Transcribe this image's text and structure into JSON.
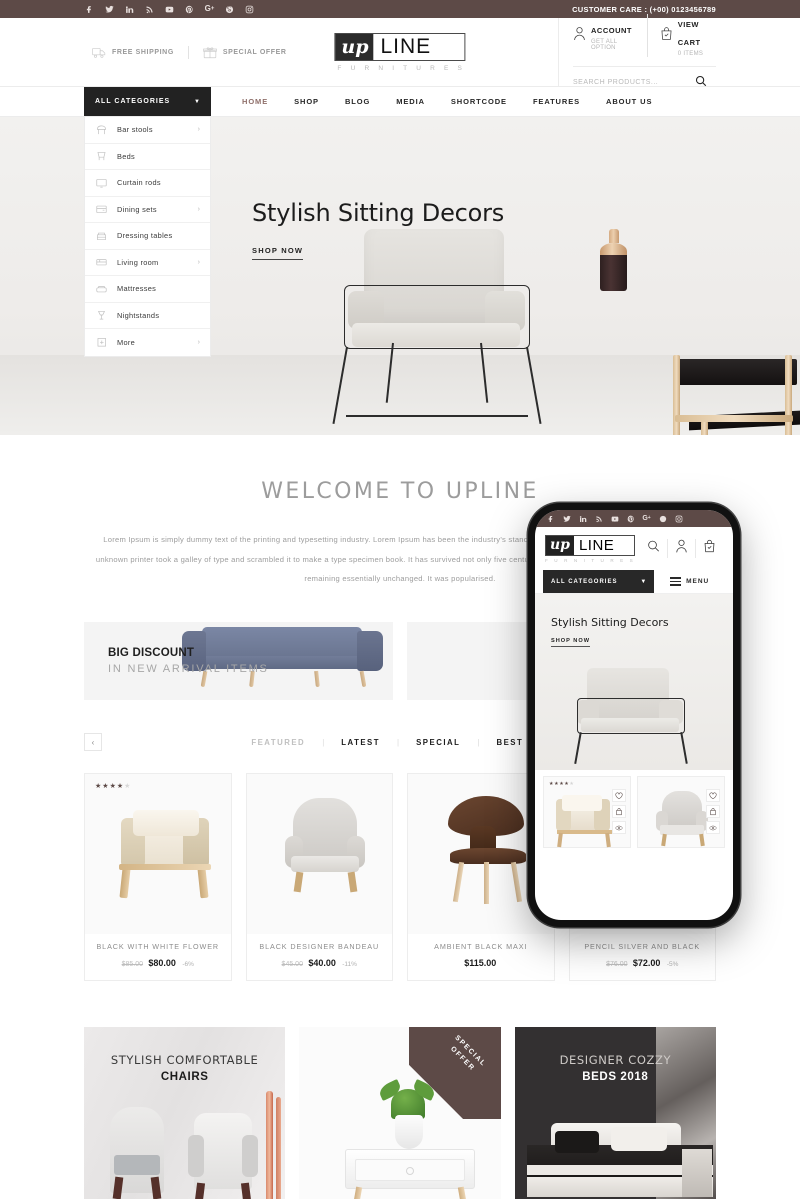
{
  "topbar": {
    "social": [
      {
        "name": "facebook-icon",
        "glyph": "f"
      },
      {
        "name": "twitter-icon",
        "glyph": "t"
      },
      {
        "name": "linkedin-icon",
        "glyph": "in"
      },
      {
        "name": "rss-icon",
        "glyph": "r"
      },
      {
        "name": "youtube-icon",
        "glyph": "y"
      },
      {
        "name": "pinterest-icon",
        "glyph": "p"
      },
      {
        "name": "google-plus-icon",
        "glyph": "G+"
      },
      {
        "name": "skype-icon",
        "glyph": "s"
      },
      {
        "name": "instagram-icon",
        "glyph": "i"
      }
    ],
    "customer_care": "CUSTOMER CARE : (+00) 0123456789",
    "bg_color": "#5d4a47"
  },
  "header": {
    "features": [
      {
        "icon": "truck-icon",
        "label": "FREE SHIPPING"
      },
      {
        "icon": "gift-icon",
        "label": "SPECIAL OFFER"
      }
    ],
    "logo": {
      "up": "up",
      "line": "LINE",
      "sub": "F U R N I T U R E S"
    },
    "account": {
      "title": "ACCOUNT",
      "sub": "GET ALL OPTION",
      "icon": "user-icon"
    },
    "cart": {
      "title": "VIEW CART",
      "sub": "0 ITEMS",
      "icon": "bag-icon"
    },
    "search": {
      "placeholder": "SEARCH PRODUCTS...",
      "value": "",
      "icon": "search-icon"
    }
  },
  "nav": {
    "categories_label": "ALL CATEGORIES",
    "items": [
      {
        "label": "HOME",
        "active": true
      },
      {
        "label": "SHOP",
        "active": false
      },
      {
        "label": "BLOG",
        "active": false
      },
      {
        "label": "MEDIA",
        "active": false
      },
      {
        "label": "SHORTCODE",
        "active": false
      },
      {
        "label": "FEATURES",
        "active": false
      },
      {
        "label": "ABOUT US",
        "active": false
      }
    ],
    "accent_color": "#8f6f6a"
  },
  "categories": [
    {
      "label": "Bar stools",
      "icon": "stool-icon",
      "arrow": true
    },
    {
      "label": "Beds",
      "icon": "bed-icon",
      "arrow": false
    },
    {
      "label": "Curtain rods",
      "icon": "curtain-icon",
      "arrow": false
    },
    {
      "label": "Dining sets",
      "icon": "dining-icon",
      "arrow": true
    },
    {
      "label": "Dressing tables",
      "icon": "dresser-icon",
      "arrow": false
    },
    {
      "label": "Living room",
      "icon": "sofa-icon",
      "arrow": true
    },
    {
      "label": "Mattresses",
      "icon": "mattress-icon",
      "arrow": false
    },
    {
      "label": "Nightstands",
      "icon": "lamp-icon",
      "arrow": false
    },
    {
      "label": "More",
      "icon": "plus-icon",
      "arrow": true
    }
  ],
  "hero": {
    "title": "Stylish Sitting Decors",
    "cta": "SHOP NOW"
  },
  "welcome": {
    "title": "WELCOME TO UPLINE",
    "paragraph": "Lorem Ipsum is simply dummy text of the printing and typesetting industry. Lorem Ipsum has been the industry's standard dummy text ever since the 1500s, when an unknown printer took a galley of type and scrambled it to make a type specimen book. It has survived not only five centuries, but also the leap into electronic typesetting, remaining essentially unchanged. It was popularised."
  },
  "promos": [
    {
      "title": "BIG DISCOUNT",
      "subtitle": "IN NEW ARRIVAL ITEMS"
    },
    {
      "title": "",
      "subtitle": ""
    }
  ],
  "product_tabs": {
    "prev_arrow": "‹",
    "separator": "|",
    "items": [
      {
        "label": "FEATURED",
        "active": false
      },
      {
        "label": "LATEST",
        "active": true
      },
      {
        "label": "SPECIAL",
        "active": true
      },
      {
        "label": "BEST SELLER",
        "active": true
      }
    ]
  },
  "products": [
    {
      "name": "BLACK WITH WHITE FLOWER",
      "old_price": "$85.00",
      "price": "$80.00",
      "discount": "-6%",
      "rating": 4,
      "max_rating": 5
    },
    {
      "name": "BLACK DESIGNER BANDEAU",
      "old_price": "$45.00",
      "price": "$40.00",
      "discount": "-11%",
      "rating": 0,
      "max_rating": 5
    },
    {
      "name": "AMBIENT BLACK MAXI",
      "old_price": "",
      "price": "$115.00",
      "discount": "",
      "rating": 0,
      "max_rating": 5
    },
    {
      "name": "PENCIL SILVER AND BLACK",
      "old_price": "$76.00",
      "price": "$72.00",
      "discount": "-5%",
      "rating": 0,
      "max_rating": 5
    }
  ],
  "banners": [
    {
      "line1": "STYLISH COMFORTABLE",
      "line2": "CHAIRS",
      "ribbon": ""
    },
    {
      "line1": "",
      "line2": "",
      "ribbon": "SPECIAL OFFER"
    },
    {
      "line1": "DESIGNER COZZY",
      "line2": "BEDS 2018",
      "ribbon": ""
    }
  ],
  "phone": {
    "categories_label": "ALL CATEGORIES",
    "menu_label": "MENU",
    "hero_title": "Stylish Sitting Decors",
    "hero_cta": "SHOP NOW",
    "logo": {
      "up": "up",
      "line": "LINE",
      "sub": "F U R N I T U R E S"
    },
    "icons": [
      {
        "name": "search-icon"
      },
      {
        "name": "user-icon"
      },
      {
        "name": "bag-icon"
      }
    ],
    "products": [
      {
        "rating": 4,
        "actions": [
          "heart-icon",
          "cart-icon",
          "eye-icon"
        ]
      },
      {
        "rating": 0,
        "actions": [
          "heart-icon",
          "cart-icon",
          "eye-icon"
        ]
      }
    ]
  }
}
